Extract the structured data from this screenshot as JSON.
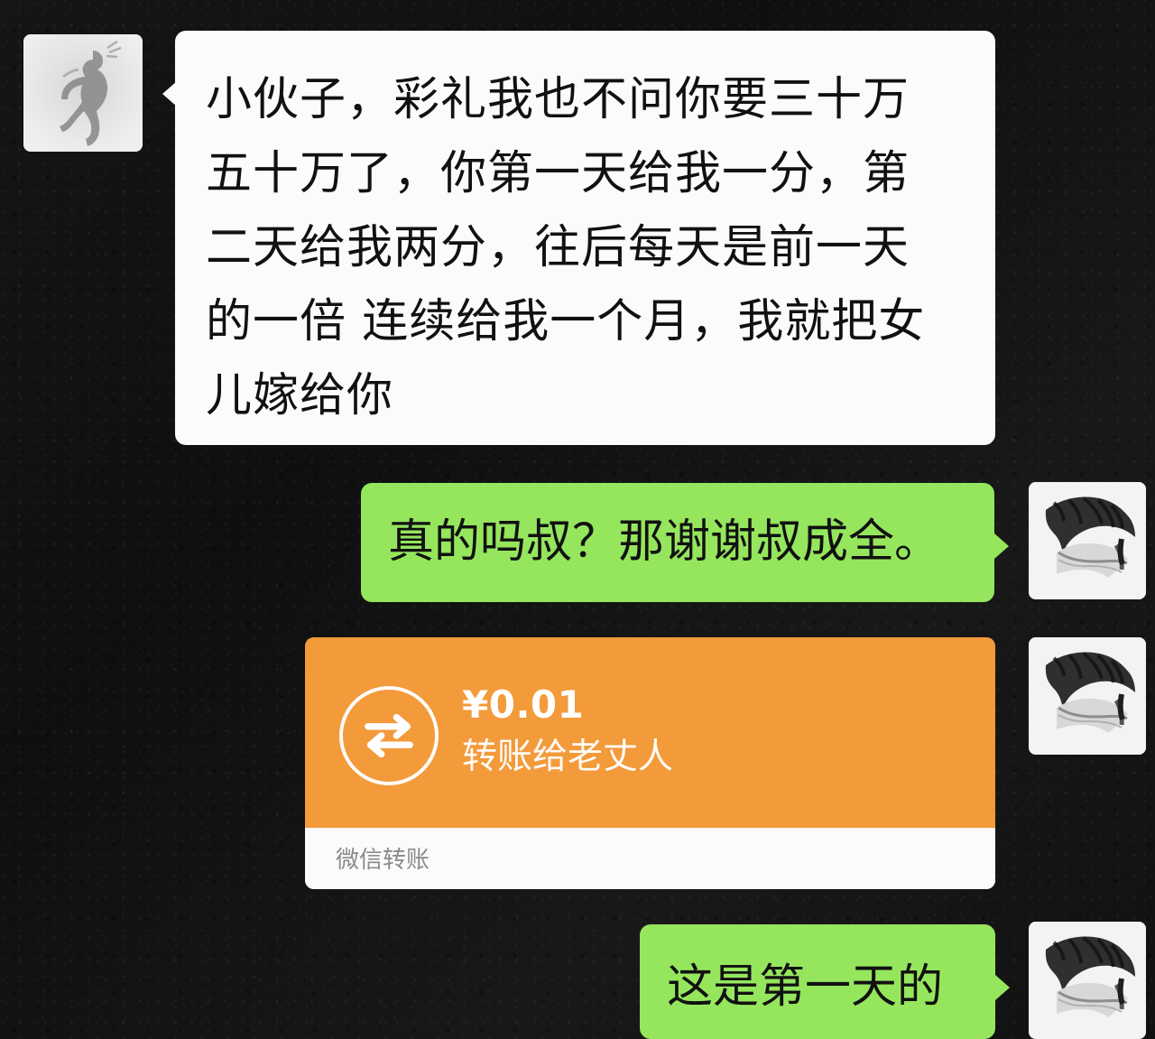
{
  "messages": [
    {
      "text": "小伙子，彩礼我也不问你要三十万\n五十万了，你第一天给我一分，第\n二天给我两分，往后每天是前一天\n的一倍 连续给我一个月，我就把女\n儿嫁给你"
    },
    {
      "text": "真的吗叔？那谢谢叔成全。"
    },
    {
      "amount": "¥0.01",
      "note": "转账给老丈人",
      "footer": "微信转账"
    },
    {
      "text": "这是第一天的"
    }
  ],
  "colors": {
    "background": "#121212",
    "white_bubble": "#fbfbfb",
    "green_bubble": "#95e65d",
    "transfer_orange": "#f39a3a",
    "footer_text": "#8b8b8b"
  },
  "icons": {
    "left_avatar": "silhouette-avatar",
    "right_avatar": "sketch-avatar",
    "transfer_icon": "transfer-arrows-icon"
  }
}
